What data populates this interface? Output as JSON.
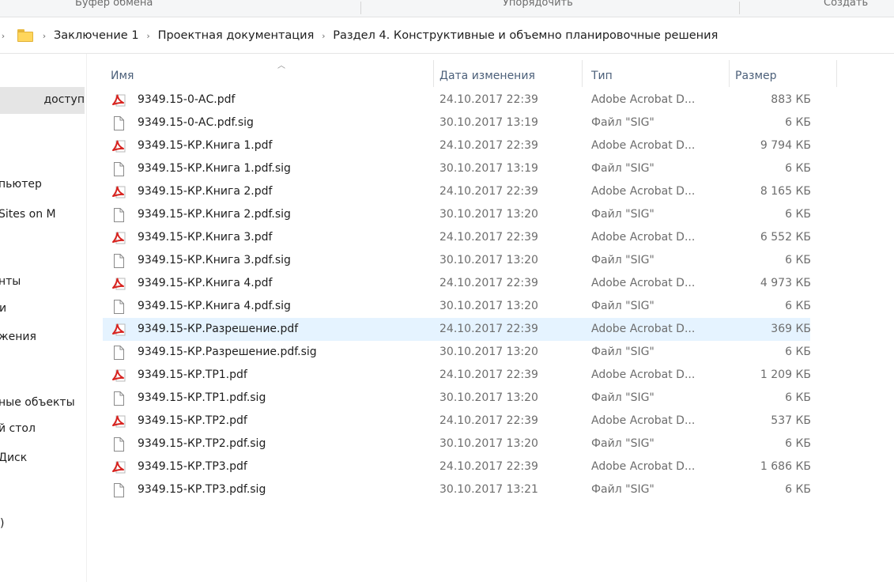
{
  "ribbon": {
    "groups": [
      "Буфер обмена",
      "Упорядочить",
      "Создать"
    ]
  },
  "breadcrumb": {
    "items": [
      "Заключение 1",
      "Проектная документация",
      "Раздел 4. Конструктивные и объемно планировочные решения"
    ]
  },
  "nav": {
    "items": [
      "доступ",
      "пьютер",
      "Sites on M",
      "нты",
      "и",
      "жения",
      "ные объекты",
      "й стол",
      "Диск",
      ")"
    ]
  },
  "columns": {
    "name": "Имя",
    "date": "Дата изменения",
    "type": "Тип",
    "size": "Размер"
  },
  "files": [
    {
      "name": "9349.15-0-АС.pdf",
      "date": "24.10.2017 22:39",
      "type": "Adobe Acrobat D...",
      "size": "883 КБ",
      "icon": "pdf-icon"
    },
    {
      "name": "9349.15-0-АС.pdf.sig",
      "date": "30.10.2017 13:19",
      "type": "Файл \"SIG\"",
      "size": "6 КБ",
      "icon": "file-icon"
    },
    {
      "name": "9349.15-КР.Книга 1.pdf",
      "date": "24.10.2017 22:39",
      "type": "Adobe Acrobat D...",
      "size": "9 794 КБ",
      "icon": "pdf-icon"
    },
    {
      "name": "9349.15-КР.Книга 1.pdf.sig",
      "date": "30.10.2017 13:19",
      "type": "Файл \"SIG\"",
      "size": "6 КБ",
      "icon": "file-icon"
    },
    {
      "name": "9349.15-КР.Книга 2.pdf",
      "date": "24.10.2017 22:39",
      "type": "Adobe Acrobat D...",
      "size": "8 165 КБ",
      "icon": "pdf-icon"
    },
    {
      "name": "9349.15-КР.Книга 2.pdf.sig",
      "date": "30.10.2017 13:20",
      "type": "Файл \"SIG\"",
      "size": "6 КБ",
      "icon": "file-icon"
    },
    {
      "name": "9349.15-КР.Книга 3.pdf",
      "date": "24.10.2017 22:39",
      "type": "Adobe Acrobat D...",
      "size": "6 552 КБ",
      "icon": "pdf-icon"
    },
    {
      "name": "9349.15-КР.Книга 3.pdf.sig",
      "date": "30.10.2017 13:20",
      "type": "Файл \"SIG\"",
      "size": "6 КБ",
      "icon": "file-icon"
    },
    {
      "name": "9349.15-КР.Книга 4.pdf",
      "date": "24.10.2017 22:39",
      "type": "Adobe Acrobat D...",
      "size": "4 973 КБ",
      "icon": "pdf-icon"
    },
    {
      "name": "9349.15-КР.Книга 4.pdf.sig",
      "date": "30.10.2017 13:20",
      "type": "Файл \"SIG\"",
      "size": "6 КБ",
      "icon": "file-icon"
    },
    {
      "name": "9349.15-КР.Разрешение.pdf",
      "date": "24.10.2017 22:39",
      "type": "Adobe Acrobat D...",
      "size": "369 КБ",
      "icon": "pdf-icon",
      "selected": true
    },
    {
      "name": "9349.15-КР.Разрешение.pdf.sig",
      "date": "30.10.2017 13:20",
      "type": "Файл \"SIG\"",
      "size": "6 КБ",
      "icon": "file-icon"
    },
    {
      "name": "9349.15-КР.ТР1.pdf",
      "date": "24.10.2017 22:39",
      "type": "Adobe Acrobat D...",
      "size": "1 209 КБ",
      "icon": "pdf-icon"
    },
    {
      "name": "9349.15-КР.ТР1.pdf.sig",
      "date": "30.10.2017 13:20",
      "type": "Файл \"SIG\"",
      "size": "6 КБ",
      "icon": "file-icon"
    },
    {
      "name": "9349.15-КР.ТР2.pdf",
      "date": "24.10.2017 22:39",
      "type": "Adobe Acrobat D...",
      "size": "537 КБ",
      "icon": "pdf-icon"
    },
    {
      "name": "9349.15-КР.ТР2.pdf.sig",
      "date": "30.10.2017 13:20",
      "type": "Файл \"SIG\"",
      "size": "6 КБ",
      "icon": "file-icon"
    },
    {
      "name": "9349.15-КР.ТР3.pdf",
      "date": "24.10.2017 22:39",
      "type": "Adobe Acrobat D...",
      "size": "1 686 КБ",
      "icon": "pdf-icon"
    },
    {
      "name": "9349.15-КР.ТР3.pdf.sig",
      "date": "30.10.2017 13:21",
      "type": "Файл \"SIG\"",
      "size": "6 КБ",
      "icon": "file-icon"
    }
  ],
  "colors": {
    "selection": "#e5f3ff",
    "header_text": "#4c607a",
    "pdf_red": "#d8231f",
    "folder_yellow": "#ffd65c"
  }
}
